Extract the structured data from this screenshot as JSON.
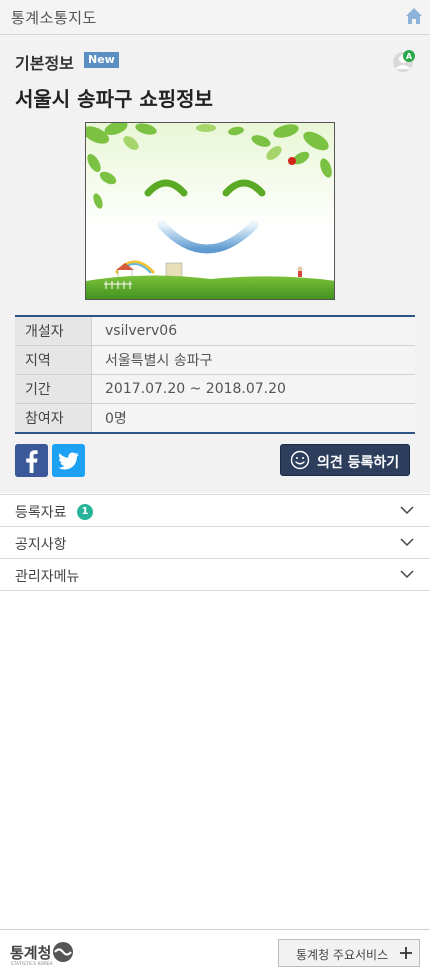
{
  "header": {
    "title": "통계소통지도",
    "home_icon": "home-icon"
  },
  "info_section": {
    "title": "기본정보",
    "badge": "New",
    "profile_icon": "user-a-icon",
    "page_title": "서울시 송파구 쇼핑정보",
    "image_alt": "smiling-nature-illustration",
    "rows": [
      {
        "label": "개설자",
        "value": "vsilverv06"
      },
      {
        "label": "지역",
        "value": "서울특별시 송파구"
      },
      {
        "label": "기간",
        "value": "2017.07.20 ~ 2018.07.20"
      },
      {
        "label": "참여자",
        "value": "0명"
      }
    ],
    "share": {
      "facebook_icon": "facebook-icon",
      "twitter_icon": "twitter-icon"
    },
    "opinion_button": "의견 등록하기"
  },
  "accordion": [
    {
      "label": "등록자료",
      "count": "1"
    },
    {
      "label": "공지사항"
    },
    {
      "label": "관리자메뉴"
    }
  ],
  "footer": {
    "logo_text": "통계청",
    "logo_sub": "STATISTICS KOREA",
    "service_button": "통계청 주요서비스"
  },
  "colors": {
    "accent": "#2d5485",
    "badge_blue": "#5a8fc2",
    "count_green": "#27b39a",
    "button_dark": "#2c3e5c"
  }
}
